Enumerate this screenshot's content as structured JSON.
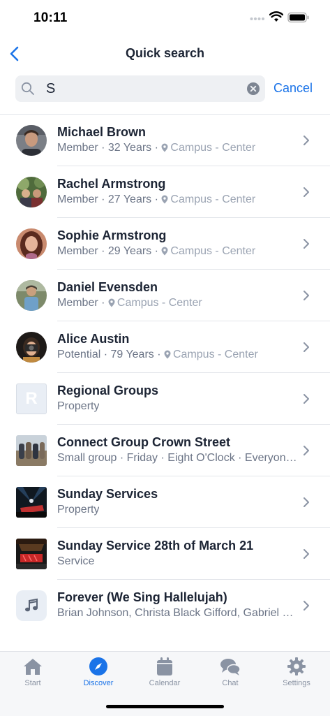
{
  "status_bar": {
    "time": "10:11"
  },
  "nav": {
    "title": "Quick search"
  },
  "search": {
    "value": "S",
    "cancel_label": "Cancel"
  },
  "results": [
    {
      "title": "Michael Brown",
      "meta": "Member · 32 Years · ",
      "location": "Campus - Center"
    },
    {
      "title": "Rachel Armstrong",
      "meta": "Member · 27 Years · ",
      "location": "Campus - Center"
    },
    {
      "title": "Sophie Armstrong",
      "meta": "Member · 29 Years · ",
      "location": "Campus - Center"
    },
    {
      "title": "Daniel Evensden",
      "meta": "Member · ",
      "location": "Campus - Center"
    },
    {
      "title": "Alice Austin",
      "meta": "Potential · 79 Years · ",
      "location": "Campus - Center"
    },
    {
      "title": "Regional Groups",
      "subtitle": "Property",
      "initial": "R"
    },
    {
      "title": "Connect Group Crown Street",
      "subtitle": "Small group · Friday · Eight O'Clock · Everyone welcome"
    },
    {
      "title": "Sunday Services",
      "subtitle": "Property"
    },
    {
      "title": "Sunday Service 28th of March 21",
      "subtitle": "Service"
    },
    {
      "title": "Forever (We Sing Hallelujah)",
      "subtitle": "Brian Johnson, Christa Black Gifford, Gabriel Wilson"
    }
  ],
  "tabs": [
    {
      "label": "Start",
      "icon": "home-icon"
    },
    {
      "label": "Discover",
      "icon": "compass-icon",
      "active": true
    },
    {
      "label": "Calendar",
      "icon": "calendar-icon"
    },
    {
      "label": "Chat",
      "icon": "chat-icon"
    },
    {
      "label": "Settings",
      "icon": "gear-icon"
    }
  ],
  "colors": {
    "accent": "#1a73e8",
    "text": "#1c2434",
    "secondary": "#6b7486",
    "muted": "#9aa3b2"
  }
}
